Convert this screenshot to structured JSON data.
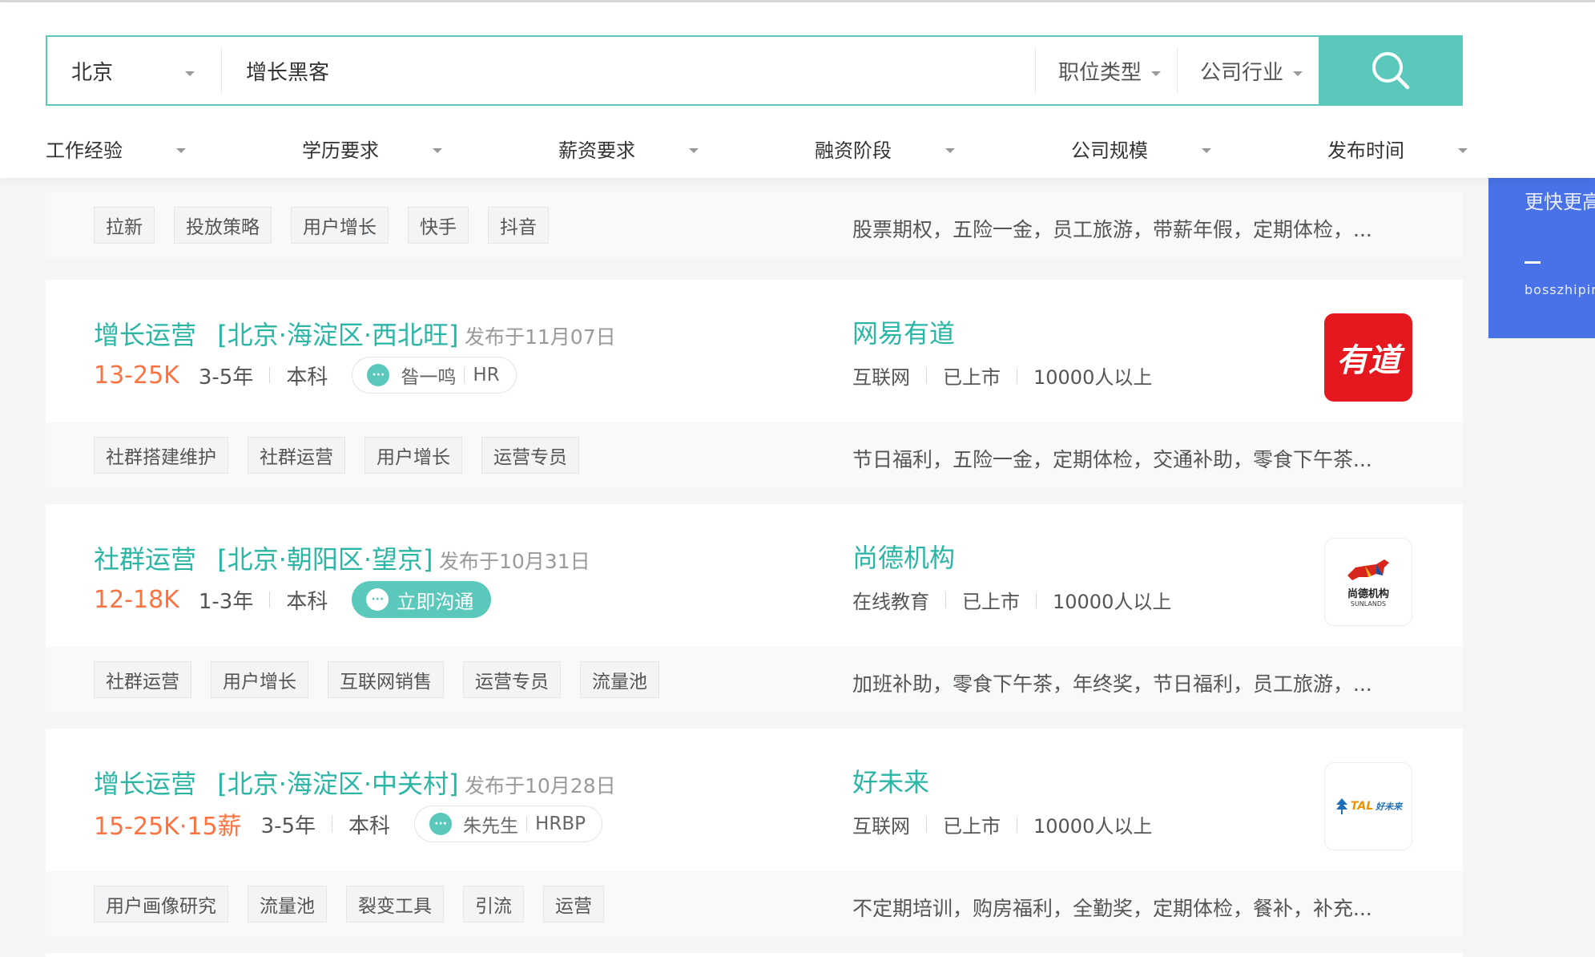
{
  "search": {
    "city": "北京",
    "query": "增长黑客",
    "filter_job_type": "职位类型",
    "filter_industry": "公司行业"
  },
  "conditions": [
    "工作经验",
    "学历要求",
    "薪资要求",
    "融资阶段",
    "公司规模",
    "发布时间"
  ],
  "side_banner": {
    "title": "更快更高",
    "subtitle": "bosszhipin"
  },
  "partial_card": {
    "tags": [
      "拉新",
      "投放策略",
      "用户增长",
      "快手",
      "抖音"
    ],
    "benefits": "股票期权，五险一金，员工旅游，带薪年假，定期体检，..."
  },
  "jobs": [
    {
      "title": "增长运营",
      "location": "[北京·海淀区·西北旺]",
      "published": "发布于11月07日",
      "salary": "13-25K",
      "experience": "3-5年",
      "education": "本科",
      "contact_name": "昝一鸣",
      "contact_role": "HR",
      "company": "网易有道",
      "industry": "互联网",
      "financing": "已上市",
      "size": "10000人以上",
      "logo_text": "有道",
      "tags": [
        "社群搭建维护",
        "社群运营",
        "用户增长",
        "运营专员"
      ],
      "benefits": "节日福利，五险一金，定期体检，交通补助，零食下午茶..."
    },
    {
      "title": "社群运营",
      "location": "[北京·朝阳区·望京]",
      "published": "发布于10月31日",
      "salary": "12-18K",
      "experience": "1-3年",
      "education": "本科",
      "chat_label": "立即沟通",
      "company": "尚德机构",
      "industry": "在线教育",
      "financing": "已上市",
      "size": "10000人以上",
      "logo_text": "尚德机构",
      "logo_subtext": "SUNLANDS",
      "tags": [
        "社群运营",
        "用户增长",
        "互联网销售",
        "运营专员",
        "流量池"
      ],
      "benefits": "加班补助，零食下午茶，年终奖，节日福利，员工旅游，..."
    },
    {
      "title": "增长运营",
      "location": "[北京·海淀区·中关村]",
      "published": "发布于10月28日",
      "salary": "15-25K·15薪",
      "experience": "3-5年",
      "education": "本科",
      "contact_name": "朱先生",
      "contact_role": "HRBP",
      "company": "好未来",
      "industry": "互联网",
      "financing": "已上市",
      "size": "10000人以上",
      "logo_text": "TAL",
      "logo_subtext": "好未来",
      "tags": [
        "用户画像研究",
        "流量池",
        "裂变工具",
        "引流",
        "运营"
      ],
      "benefits": "不定期培训，购房福利，全勤奖，定期体检，餐补，补充..."
    }
  ],
  "colors": {
    "accent": "#5ac8bb",
    "link": "#2ab5a5",
    "salary": "#fd7240",
    "banner": "#4a72e8",
    "youdao_logo": "#e5171f"
  }
}
